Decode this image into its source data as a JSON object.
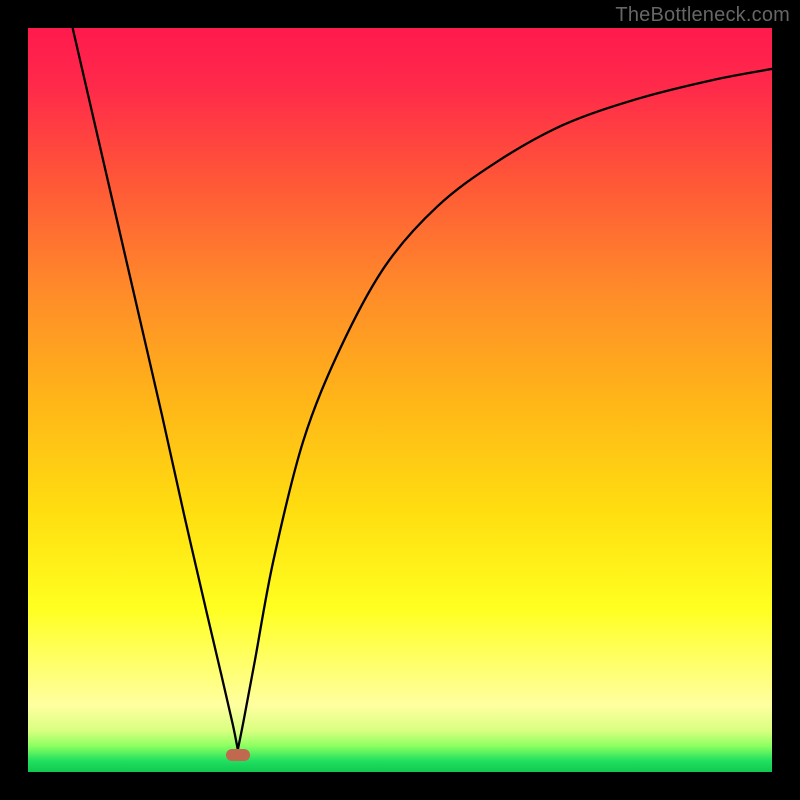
{
  "watermark": "TheBottleneck.com",
  "marker": {
    "x_frac": 0.282,
    "y_frac": 0.977,
    "color": "#c1694f"
  },
  "gradient_stops": [
    {
      "offset": 0.0,
      "color": "#ff1a4d"
    },
    {
      "offset": 0.08,
      "color": "#ff2a4a"
    },
    {
      "offset": 0.2,
      "color": "#ff5538"
    },
    {
      "offset": 0.35,
      "color": "#ff8a2a"
    },
    {
      "offset": 0.5,
      "color": "#ffb518"
    },
    {
      "offset": 0.65,
      "color": "#ffde10"
    },
    {
      "offset": 0.78,
      "color": "#ffff20"
    },
    {
      "offset": 0.86,
      "color": "#ffff70"
    },
    {
      "offset": 0.91,
      "color": "#ffffa0"
    },
    {
      "offset": 0.945,
      "color": "#d8ff80"
    },
    {
      "offset": 0.965,
      "color": "#8cff60"
    },
    {
      "offset": 0.985,
      "color": "#20e060"
    },
    {
      "offset": 1.0,
      "color": "#10c850"
    }
  ],
  "chart_data": {
    "type": "line",
    "title": "",
    "xlabel": "",
    "ylabel": "",
    "xlim": [
      0,
      1
    ],
    "ylim": [
      0,
      1
    ],
    "grid": false,
    "legend": false,
    "series": [
      {
        "name": "curve",
        "x": [
          0.06,
          0.09,
          0.12,
          0.15,
          0.18,
          0.21,
          0.24,
          0.26,
          0.275,
          0.282,
          0.29,
          0.305,
          0.33,
          0.37,
          0.42,
          0.48,
          0.55,
          0.63,
          0.72,
          0.82,
          0.92,
          1.0
        ],
        "y": [
          1.0,
          0.87,
          0.74,
          0.61,
          0.48,
          0.345,
          0.215,
          0.13,
          0.065,
          0.03,
          0.07,
          0.15,
          0.285,
          0.445,
          0.57,
          0.68,
          0.76,
          0.82,
          0.87,
          0.905,
          0.93,
          0.945
        ]
      }
    ],
    "annotations": [
      {
        "type": "marker",
        "x": 0.282,
        "y": 0.023,
        "label": ""
      }
    ]
  }
}
